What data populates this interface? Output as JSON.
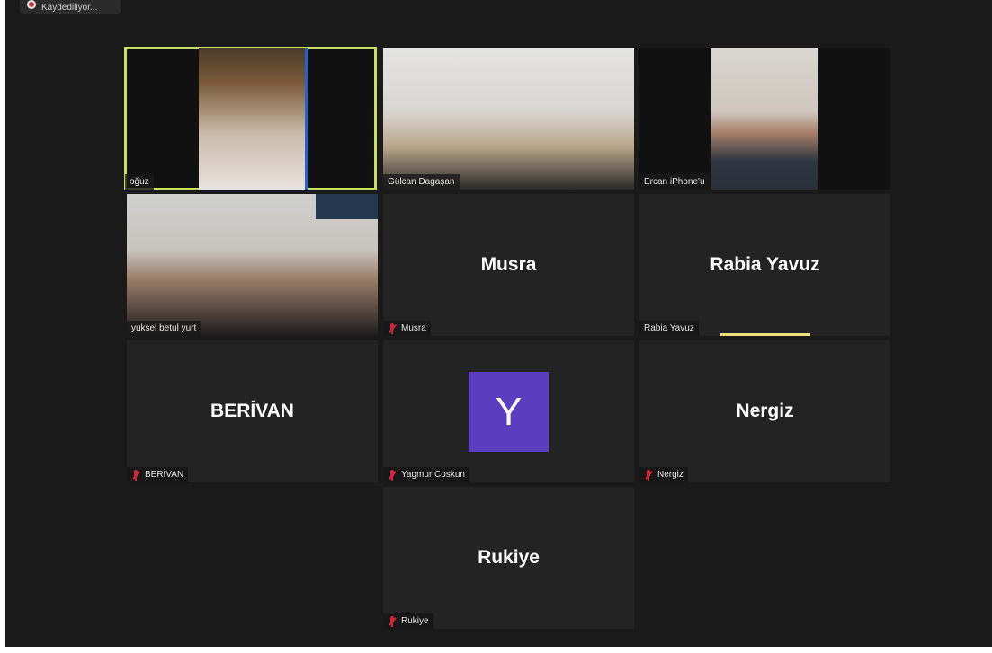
{
  "recording": {
    "label": "Kaydediliyor..."
  },
  "tiles": [
    {
      "id": "oguz",
      "label": "oğuz",
      "type": "video"
    },
    {
      "id": "gulcan",
      "label": "Gülcan Dagaşan",
      "type": "video"
    },
    {
      "id": "ercan",
      "label": "Ercan iPhone'u",
      "type": "video"
    },
    {
      "id": "yuksel",
      "label": "yuksel betul yurt",
      "type": "video"
    },
    {
      "id": "musra",
      "name": "Musra",
      "label": "Musra",
      "type": "name",
      "muted": true
    },
    {
      "id": "rabia",
      "name": "Rabia Yavuz",
      "label": "Rabia Yavuz",
      "type": "name",
      "muted": false
    },
    {
      "id": "berivan",
      "name": "BERİVAN",
      "label": "BERİVAN",
      "type": "name",
      "muted": true
    },
    {
      "id": "yagmur",
      "initial": "Y",
      "label": "Yagmur Coskun",
      "type": "avatar",
      "muted": true
    },
    {
      "id": "nergiz",
      "name": "Nergiz",
      "label": "Nergiz",
      "type": "name",
      "muted": true
    },
    {
      "id": "rukiye",
      "name": "Rukiye",
      "label": "Rukiye",
      "type": "name",
      "muted": true
    }
  ],
  "colors": {
    "active_speaker": "#c9e25a",
    "avatar": "#5b3ec0",
    "muted_icon": "#d0263a"
  }
}
